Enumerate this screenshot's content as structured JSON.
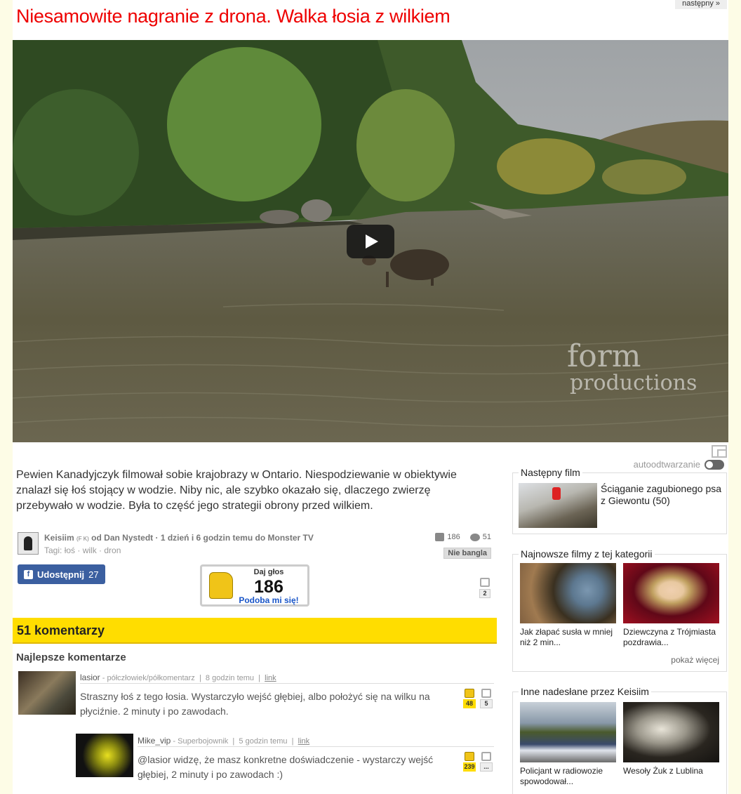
{
  "header": {
    "title": "Niesamowite nagranie z drona. Walka łosia z wilkiem",
    "next_label": "następny »"
  },
  "video": {
    "watermark_line1": "form",
    "watermark_line2": "productions",
    "autoplay_label": "autoodtwarzanie"
  },
  "description": "Pewien Kanadyjczyk filmował sobie krajobrazy w Ontario. Niespodziewanie w obiektywie znalazł się łoś stojący w wodzie. Niby nic, ale szybko okazało się, dlaczego zwierzę przebywało w wodzie. Była to część jego strategii obrony przed wilkiem.",
  "author": {
    "name": "Keisiim",
    "flag": "(F K)",
    "meta": "od Dan Nystedt · 1 dzień i 6 godzin temu do Monster TV",
    "tags_label": "Tagi:",
    "tags": "łoś · wilk · dron",
    "likes": "186",
    "comments": "51",
    "nie_bangla": "Nie bangla"
  },
  "share": {
    "label": "Udostępnij",
    "count": "27",
    "fb_glyph": "f"
  },
  "vote": {
    "prompt": "Daj głos",
    "count": "186",
    "action": "Podoba mi się!",
    "dislikes": "2"
  },
  "comments": {
    "header": "51 komentarzy",
    "best_label": "Najlepsze komentarze",
    "items": [
      {
        "user": "lasior",
        "rank": "półczłowiek/półkomentarz",
        "sep1": "|",
        "time": "8 godzin temu",
        "sep2": "|",
        "link": "link",
        "text": "Straszny łoś z tego łosia. Wystarczyło wejść głębiej, albo położyć się na wilku na płyciźnie. 2 minuty i po zawodach.",
        "up": "48",
        "down": "5"
      },
      {
        "user": "Mike_vip",
        "rank": "Superbojownik",
        "sep1": "|",
        "time": "5 godzin temu",
        "sep2": "|",
        "link": "link",
        "text": "@lasior widzę, że masz konkretne doświadczenie - wystarczy wejść głębiej, 2 minuty i po zawodach :)",
        "up": "239",
        "down": "..."
      }
    ]
  },
  "sidebar": {
    "next_film": {
      "title": "Następny film",
      "caption": "Ściąganie zagubionego psa z Giewontu (50)"
    },
    "latest": {
      "title": "Najnowsze filmy z tej kategorii",
      "items": [
        {
          "caption": "Jak złapać susła w mniej niż 2 min..."
        },
        {
          "caption": "Dziewczyna z Trójmiasta pozdrawia..."
        }
      ],
      "more": "pokaż więcej"
    },
    "other": {
      "title": "Inne nadesłane przez Keisiim",
      "items": [
        {
          "caption": "Policjant w radiowozie spowodował..."
        },
        {
          "caption": "Wesoły Żuk z Lublina"
        }
      ]
    }
  },
  "colors": {
    "title_red": "#ee0000",
    "yellow_bar": "#ffdd00",
    "facebook_blue": "#3b5fa0",
    "link_blue": "#1a56c8"
  },
  "icons": [
    "play-icon",
    "popout-icon",
    "toggle-icon",
    "thumb-up-icon",
    "comment-bubble-icon",
    "facebook-icon",
    "thumb-down-icon"
  ]
}
